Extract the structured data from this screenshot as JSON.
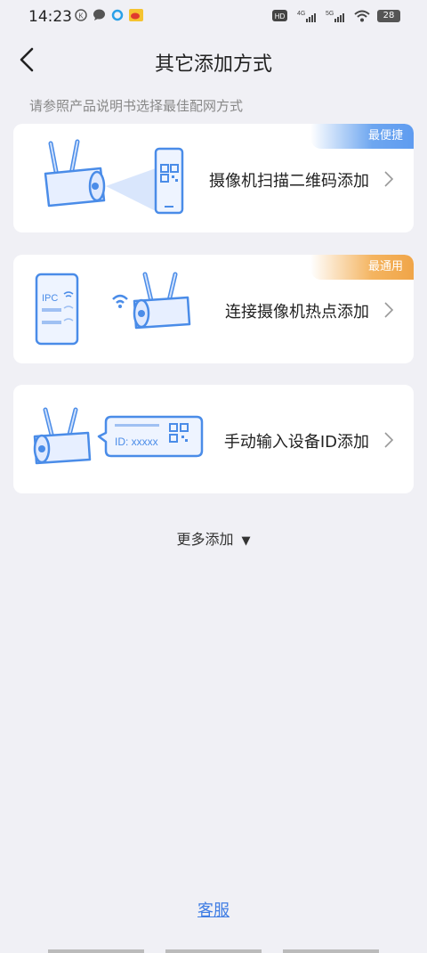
{
  "status_bar": {
    "time": "14:23",
    "left_icons": [
      "k-icon",
      "chat-icon",
      "circle-icon",
      "weibo-icon"
    ],
    "right_icons": [
      "hd-icon",
      "4g-signal-icon",
      "5g-signal-icon",
      "wifi-icon"
    ],
    "battery": "28"
  },
  "header": {
    "title": "其它添加方式"
  },
  "subtitle": "请参照产品说明书选择最佳配网方式",
  "options": [
    {
      "label": "摄像机扫描二维码添加",
      "badge": "最便捷",
      "badge_color": "#5f9cf0"
    },
    {
      "label": "连接摄像机热点添加",
      "badge": "最通用",
      "badge_color": "#f0a548",
      "illus_text": "IPC"
    },
    {
      "label": "手动输入设备ID添加",
      "illus_text": "ID: xxxxx"
    }
  ],
  "more": {
    "label": "更多添加",
    "arrow": "▼"
  },
  "footer": {
    "service_label": "客服"
  },
  "colors": {
    "accent": "#3f7de4",
    "background": "#f0f0f5",
    "illustration": "#4a8ce8"
  }
}
